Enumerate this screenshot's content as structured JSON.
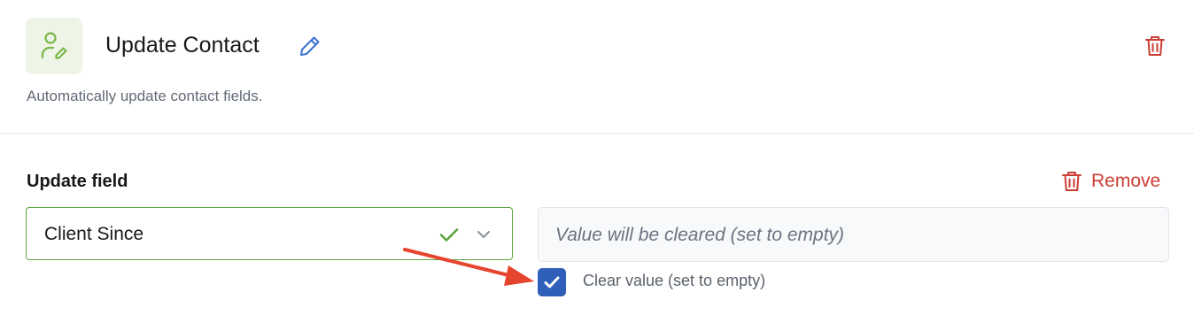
{
  "header": {
    "title": "Update Contact",
    "subtitle": "Automatically update contact fields.",
    "app_icon": "user-edit-icon",
    "edit_icon": "pencil-icon",
    "delete_icon": "trash-icon"
  },
  "field": {
    "section_label": "Update field",
    "remove_label": "Remove",
    "selected_field": "Client Since",
    "value_placeholder": "Value will be cleared (set to empty)",
    "clear_checkbox_label": "Clear value (set to empty)",
    "clear_checked": true
  },
  "colors": {
    "accent_green": "#5da542",
    "danger_red": "#cc3d33",
    "checkbox_blue": "#2f5fb8",
    "annotation_arrow": "#e5452e",
    "icon_bg": "#eff5e6",
    "edit_blue": "#3a6fd0"
  }
}
